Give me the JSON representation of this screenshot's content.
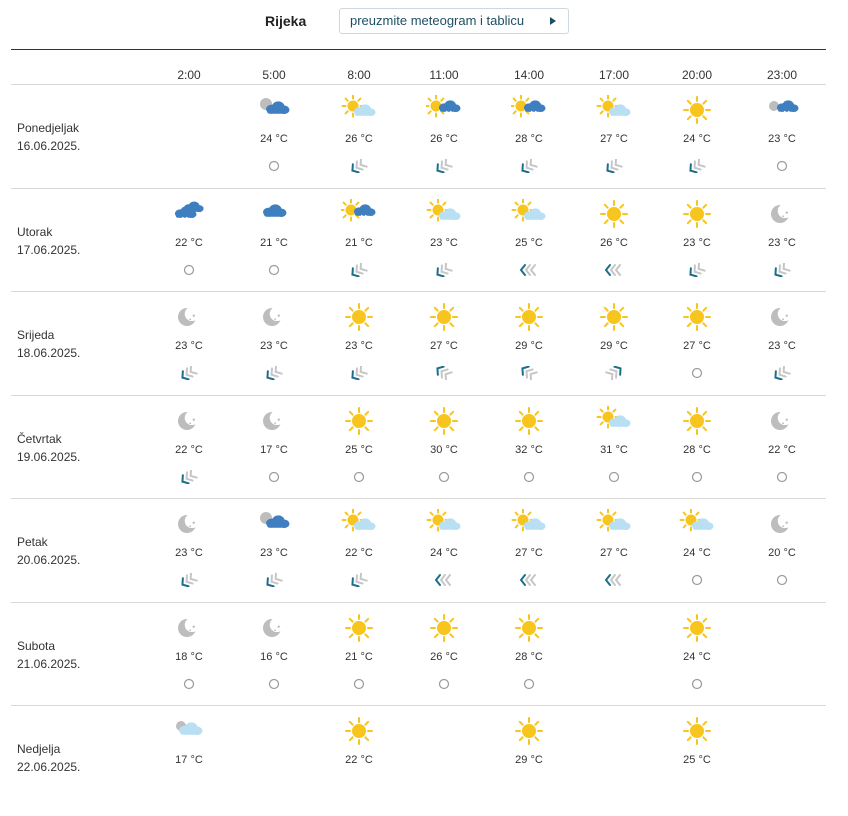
{
  "header": {
    "city": "Rijeka",
    "download_label": "preuzmite meteogram i tablicu"
  },
  "hours": [
    "2:00",
    "5:00",
    "8:00",
    "11:00",
    "14:00",
    "17:00",
    "20:00",
    "23:00"
  ],
  "days": [
    {
      "name": "Ponedjeljak",
      "date": "16.06.2025.",
      "cells": [
        null,
        {
          "icon": "partly-cloudy-night-icon",
          "temp": "24 °C",
          "wind": "calm-icon"
        },
        {
          "icon": "sun-cloud-icon",
          "temp": "26 °C",
          "wind": "wind-sw-icon"
        },
        {
          "icon": "sun-rain-icon",
          "temp": "26 °C",
          "wind": "wind-sw-icon"
        },
        {
          "icon": "sun-rain-icon",
          "temp": "28 °C",
          "wind": "wind-sw-icon"
        },
        {
          "icon": "sun-cloud-icon",
          "temp": "27 °C",
          "wind": "wind-sw-icon"
        },
        {
          "icon": "sun-icon",
          "temp": "24 °C",
          "wind": "wind-sw-icon"
        },
        {
          "icon": "night-rain-icon",
          "temp": "23 °C",
          "wind": "calm-icon"
        }
      ]
    },
    {
      "name": "Utorak",
      "date": "17.06.2025.",
      "cells": [
        {
          "icon": "rain-cloud-icon",
          "temp": "22 °C",
          "wind": "calm-icon"
        },
        {
          "icon": "cloud-icon",
          "temp": "21 °C",
          "wind": "calm-icon"
        },
        {
          "icon": "sun-rain-icon",
          "temp": "21 °C",
          "wind": "wind-sw-icon"
        },
        {
          "icon": "sun-cloud-icon",
          "temp": "23 °C",
          "wind": "wind-sw-icon"
        },
        {
          "icon": "sun-cloud-icon",
          "temp": "25 °C",
          "wind": "wind-w-icon"
        },
        {
          "icon": "sun-icon",
          "temp": "26 °C",
          "wind": "wind-w-icon"
        },
        {
          "icon": "sun-icon",
          "temp": "23 °C",
          "wind": "wind-sw-icon"
        },
        {
          "icon": "moon-icon",
          "temp": "23 °C",
          "wind": "wind-sw-icon"
        }
      ]
    },
    {
      "name": "Srijeda",
      "date": "18.06.2025.",
      "cells": [
        {
          "icon": "moon-icon",
          "temp": "23 °C",
          "wind": "wind-sw-icon"
        },
        {
          "icon": "moon-icon",
          "temp": "23 °C",
          "wind": "wind-sw-icon"
        },
        {
          "icon": "sun-icon",
          "temp": "23 °C",
          "wind": "wind-sw-icon"
        },
        {
          "icon": "sun-icon",
          "temp": "27 °C",
          "wind": "wind-nw-icon"
        },
        {
          "icon": "sun-icon",
          "temp": "29 °C",
          "wind": "wind-nw-icon"
        },
        {
          "icon": "sun-icon",
          "temp": "29 °C",
          "wind": "wind-ne-icon"
        },
        {
          "icon": "sun-icon",
          "temp": "27 °C",
          "wind": "calm-icon"
        },
        {
          "icon": "moon-icon",
          "temp": "23 °C",
          "wind": "wind-sw-icon"
        }
      ]
    },
    {
      "name": "Četvrtak",
      "date": "19.06.2025.",
      "cells": [
        {
          "icon": "moon-icon",
          "temp": "22 °C",
          "wind": "wind-sw-icon"
        },
        {
          "icon": "moon-icon",
          "temp": "17 °C",
          "wind": "calm-icon"
        },
        {
          "icon": "sun-icon",
          "temp": "25 °C",
          "wind": "calm-icon"
        },
        {
          "icon": "sun-icon",
          "temp": "30 °C",
          "wind": "calm-icon"
        },
        {
          "icon": "sun-icon",
          "temp": "32 °C",
          "wind": "calm-icon"
        },
        {
          "icon": "sun-cloud-icon",
          "temp": "31 °C",
          "wind": "calm-icon"
        },
        {
          "icon": "sun-icon",
          "temp": "28 °C",
          "wind": "calm-icon"
        },
        {
          "icon": "moon-icon",
          "temp": "22 °C",
          "wind": "calm-icon"
        }
      ]
    },
    {
      "name": "Petak",
      "date": "20.06.2025.",
      "cells": [
        {
          "icon": "moon-icon",
          "temp": "23 °C",
          "wind": "wind-sw-icon"
        },
        {
          "icon": "partly-cloudy-night-icon",
          "temp": "23 °C",
          "wind": "wind-sw-icon"
        },
        {
          "icon": "sun-cloud-icon",
          "temp": "22 °C",
          "wind": "wind-sw-icon"
        },
        {
          "icon": "sun-cloud-icon",
          "temp": "24 °C",
          "wind": "wind-w-icon"
        },
        {
          "icon": "sun-cloud-icon",
          "temp": "27 °C",
          "wind": "wind-w-icon"
        },
        {
          "icon": "sun-cloud-icon",
          "temp": "27 °C",
          "wind": "wind-w-icon"
        },
        {
          "icon": "sun-cloud-icon",
          "temp": "24 °C",
          "wind": "calm-icon"
        },
        {
          "icon": "moon-icon",
          "temp": "20 °C",
          "wind": "calm-icon"
        }
      ]
    },
    {
      "name": "Subota",
      "date": "21.06.2025.",
      "cells": [
        {
          "icon": "moon-icon",
          "temp": "18 °C",
          "wind": "calm-icon"
        },
        {
          "icon": "moon-icon",
          "temp": "16 °C",
          "wind": "calm-icon"
        },
        {
          "icon": "sun-icon",
          "temp": "21 °C",
          "wind": "calm-icon"
        },
        {
          "icon": "sun-icon",
          "temp": "26 °C",
          "wind": "calm-icon"
        },
        {
          "icon": "sun-icon",
          "temp": "28 °C",
          "wind": "calm-icon"
        },
        null,
        {
          "icon": "sun-icon",
          "temp": "24 °C",
          "wind": "calm-icon"
        },
        null
      ]
    },
    {
      "name": "Nedjelja",
      "date": "22.06.2025.",
      "cells": [
        {
          "icon": "cloud-light-icon",
          "temp": "17 °C",
          "wind": null
        },
        null,
        {
          "icon": "sun-icon",
          "temp": "22 °C",
          "wind": null
        },
        null,
        {
          "icon": "sun-icon",
          "temp": "29 °C",
          "wind": null
        },
        null,
        {
          "icon": "sun-icon",
          "temp": "25 °C",
          "wind": null
        },
        null
      ]
    }
  ],
  "colors": {
    "sun": "#f7c51e",
    "cloud_dark": "#3f7fbf",
    "cloud_light": "#b9dff3",
    "moon": "#bdbdbd",
    "wind_dark": "#1d6e8a",
    "wind_light": "#c6c6c6",
    "accent": "#1d4f63"
  }
}
